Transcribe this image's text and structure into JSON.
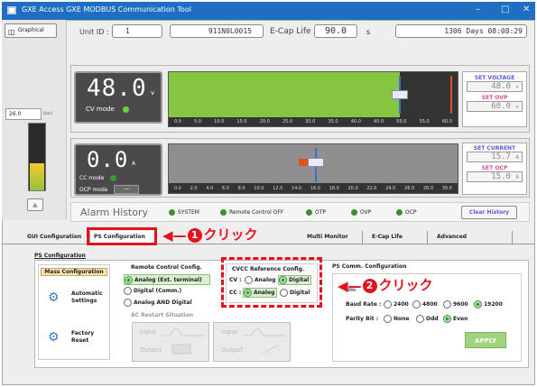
{
  "window": {
    "title": "GXE Access  GXE MODBUS Communication Tool",
    "min": "–",
    "max": "□",
    "close": "✕"
  },
  "left": {
    "graphical": "Graphical",
    "level_value": "26.0",
    "level_unit": "[bar]"
  },
  "header": {
    "unit_id_label": "Unit ID :",
    "unit_id": "1",
    "serial": "911N0L0015",
    "ecap_label": "E-Cap Life",
    "ecap_value": "90.0",
    "ecap_unit": "s",
    "days": "1306 Days 08:08:29"
  },
  "voltage": {
    "display": "48.0",
    "unit": "v",
    "mode_label": "CV mode",
    "bar_fill": 0.8,
    "ticks": [
      "0.0",
      "5.0",
      "10.0",
      "15.0",
      "20.0",
      "25.0",
      "30.0",
      "35.0",
      "40.0",
      "45.0",
      "50.0",
      "55.0",
      "60.0"
    ],
    "set_label": "SET VOLTAGE",
    "set_value": "48.0",
    "set_unit": "v",
    "ovp_label": "SET OVP",
    "ovp_value": "60.0",
    "ovp_unit": "v"
  },
  "current": {
    "display": "0.0",
    "unit": "A",
    "cc_label": "CC mode",
    "ocp_label": "OCP mode",
    "ocp_value": "—",
    "ticks": [
      "0.0",
      "2.0",
      "4.0",
      "6.0",
      "8.0",
      "10.0",
      "12.0",
      "14.0",
      "16.0",
      "18.0",
      "20.0",
      "22.0",
      "24.0",
      "26.0",
      "28.0",
      "30.0"
    ],
    "set_label": "SET CURRENT",
    "set_value": "15.7",
    "set_unit": "A",
    "ocp_set_label": "SET OCP",
    "ocp_set_value": "15.0",
    "ocp_set_unit": "A"
  },
  "alarm": {
    "title": "Alarm History",
    "items": [
      "SYSTEM",
      "Remote Control OFF",
      "OTP",
      "OVP",
      "OCP"
    ],
    "clear": "Clear History"
  },
  "tabs": [
    "GUI Configuration",
    "PS Configuration",
    "Multi Monitor",
    "E-Cap Life",
    "Advanced"
  ],
  "ps": {
    "section": "PS Configuration",
    "mass": "Mass Configuration",
    "auto": [
      "Automatic",
      "Settings"
    ],
    "factory": [
      "Factory",
      "Reset"
    ],
    "remote_title": "Remote Control Config.",
    "remote_opts": [
      "Analog (Ext. terminal)",
      "Digital (Comm.)",
      "Analog AND Digital"
    ],
    "ac_title": "AC Restart Situation",
    "ac_boxes": [
      "Input",
      "Output",
      "Input",
      "Output"
    ],
    "cvcc_title": "CVCC Reference Config.",
    "cv_label": "CV :",
    "cc_label": "CC :",
    "analog": "Analog",
    "digital": "Digital",
    "comm_title": "PS Comm. Configuration",
    "unit_id_short": "Uni",
    "baud_label": "Baud Rate :",
    "baud_opts": [
      "2400",
      "4800",
      "9600",
      "19200"
    ],
    "parity_label": "Parity Bit :",
    "parity_opts": [
      "None",
      "Odd",
      "Even"
    ],
    "apply": "APPLY"
  },
  "callouts": {
    "c1_num": "1",
    "c1_text": "クリック",
    "c2_num": "2",
    "c2_text": "クリック"
  },
  "colors": {
    "accent": "#e3131e",
    "green_bar": "#86c540",
    "titlebar": "#1f6ec2"
  }
}
